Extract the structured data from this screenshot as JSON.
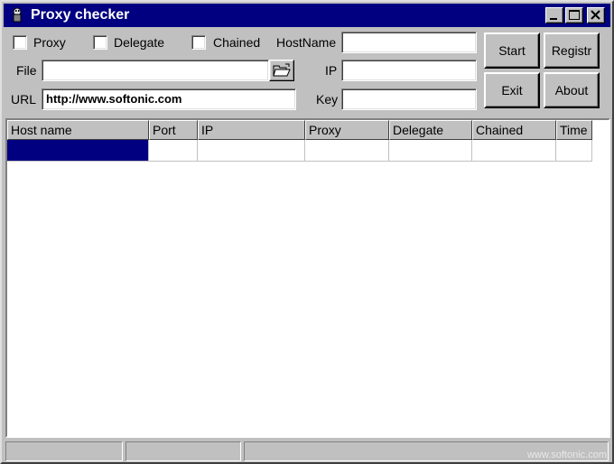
{
  "window": {
    "title": "Proxy checker",
    "icon": "proxy-checker-app-icon"
  },
  "titlebar_buttons": [
    "minimize-icon",
    "maximize-icon",
    "close-icon"
  ],
  "options": {
    "proxy_label": "Proxy",
    "delegate_label": "Delegate",
    "chained_label": "Chained",
    "proxy_checked": false,
    "delegate_checked": false,
    "chained_checked": false
  },
  "fields": {
    "file_label": "File",
    "file_value": "",
    "url_label": "URL",
    "url_value": "http://www.softonic.com",
    "hostname_label": "HostName",
    "hostname_value": "",
    "ip_label": "IP",
    "ip_value": "",
    "key_label": "Key",
    "key_value": ""
  },
  "buttons": {
    "start": "Start",
    "register": "Registr",
    "exit": "Exit",
    "about": "About"
  },
  "table": {
    "columns": [
      "Host name",
      "Port",
      "IP",
      "Proxy",
      "Delegate",
      "Chained",
      "Time"
    ],
    "rows": [
      [
        "",
        "",
        "",
        "",
        "",
        "",
        ""
      ]
    ],
    "selected_row": 0
  },
  "status_bar": [
    "",
    "",
    ""
  ],
  "watermark": "www.softonic.com",
  "colors": {
    "titlebar": "#000080",
    "face": "#c0c0c0",
    "selection": "#000080"
  }
}
